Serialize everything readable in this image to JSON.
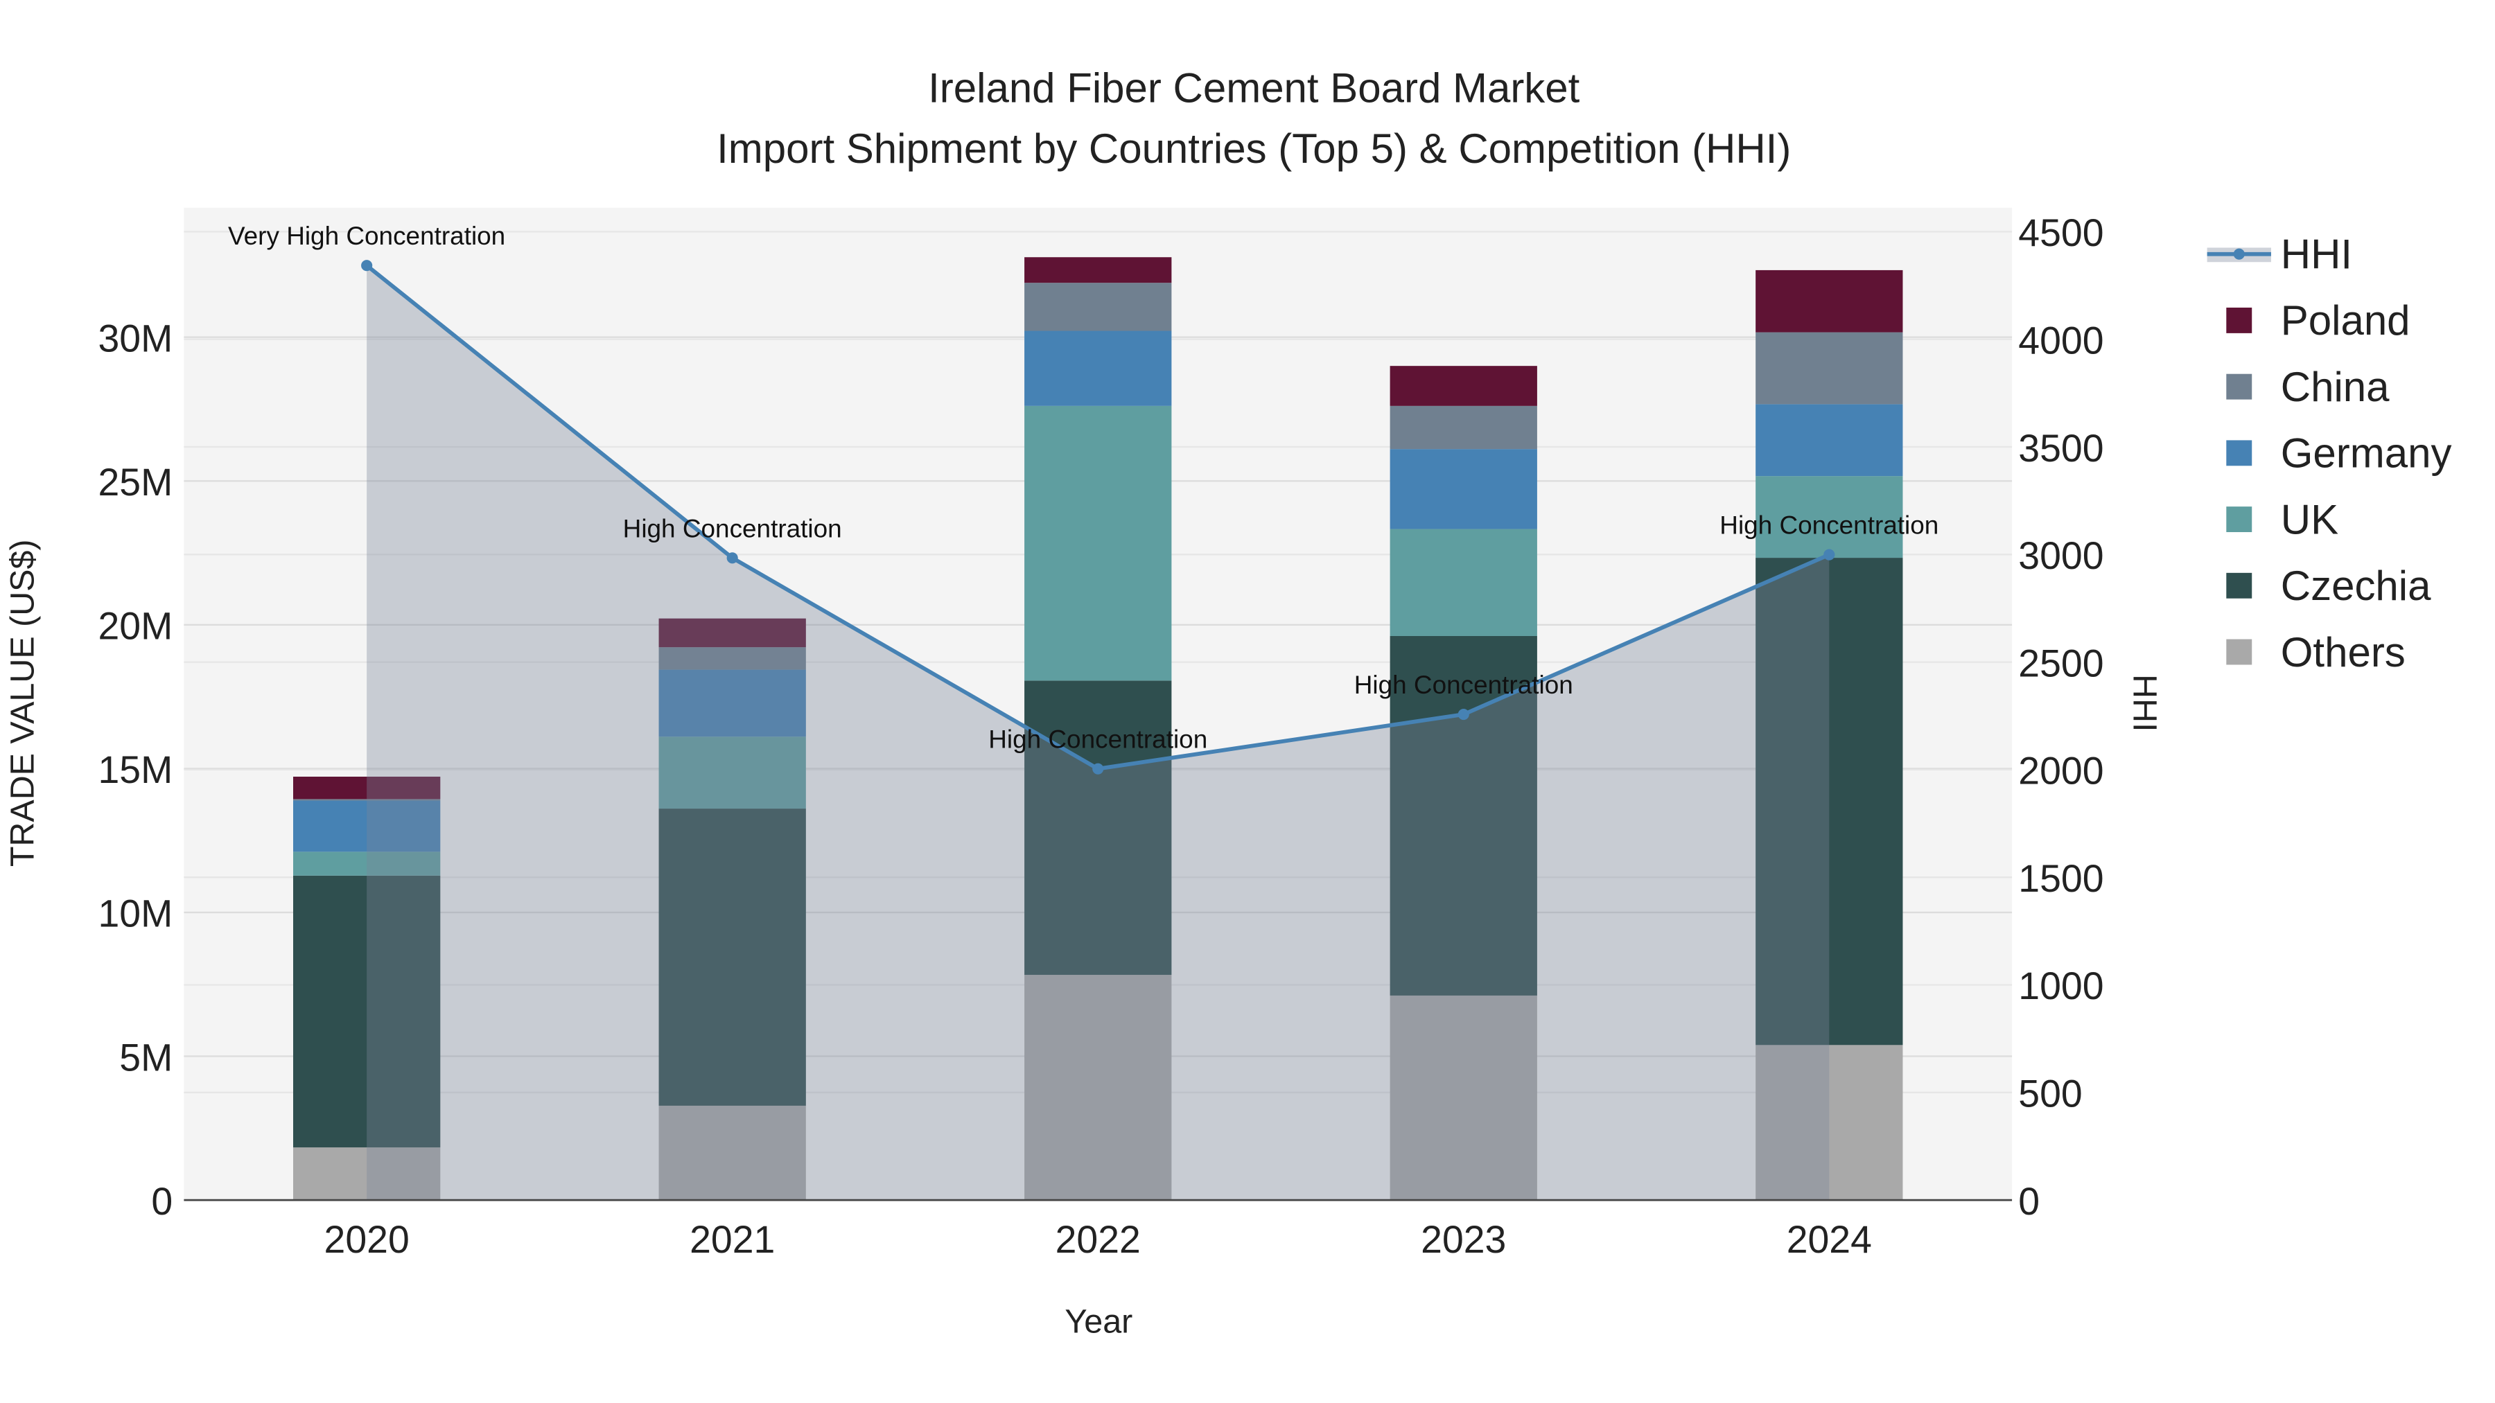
{
  "chart_data": {
    "type": "bar",
    "stacked": true,
    "title": "Ireland Fiber Cement Board Market",
    "subtitle": "Import Shipment by Countries (Top 5) & Competition (HHI)",
    "xlabel": "Year",
    "ylabel": "TRADE VALUE (US$)",
    "y2label": "HHI",
    "categories": [
      "2020",
      "2021",
      "2022",
      "2023",
      "2024"
    ],
    "ylim": [
      0,
      34500000
    ],
    "y2lim": [
      0,
      4600
    ],
    "yticks": [
      {
        "v": 0,
        "label": "0"
      },
      {
        "v": 5000000,
        "label": "5M"
      },
      {
        "v": 10000000,
        "label": "10M"
      },
      {
        "v": 15000000,
        "label": "15M"
      },
      {
        "v": 20000000,
        "label": "20M"
      },
      {
        "v": 25000000,
        "label": "25M"
      },
      {
        "v": 30000000,
        "label": "30M"
      }
    ],
    "y2ticks": [
      {
        "v": 0,
        "label": "0"
      },
      {
        "v": 500,
        "label": "500"
      },
      {
        "v": 1000,
        "label": "1000"
      },
      {
        "v": 1500,
        "label": "1500"
      },
      {
        "v": 2000,
        "label": "2000"
      },
      {
        "v": 2500,
        "label": "2500"
      },
      {
        "v": 3000,
        "label": "3000"
      },
      {
        "v": 3500,
        "label": "3500"
      },
      {
        "v": 4000,
        "label": "4000"
      },
      {
        "v": 4500,
        "label": "4500"
      }
    ],
    "grid": true,
    "legend_position": "right",
    "series": [
      {
        "name": "Others",
        "color": "#a9a9a9",
        "values": [
          1830000,
          3280000,
          7830000,
          7110000,
          5390000
        ]
      },
      {
        "name": "Czechia",
        "color": "#2f4f4f",
        "values": [
          9450000,
          10330000,
          10230000,
          12500000,
          16940000
        ]
      },
      {
        "name": "UK",
        "color": "#5f9ea0",
        "values": [
          830000,
          2500000,
          9550000,
          3720000,
          2840000
        ]
      },
      {
        "name": "Germany",
        "color": "#4682b4",
        "values": [
          1780000,
          2330000,
          2610000,
          2780000,
          2500000
        ]
      },
      {
        "name": "China",
        "color": "#708090",
        "values": [
          50000,
          780000,
          1670000,
          1500000,
          2500000
        ]
      },
      {
        "name": "Poland",
        "color": "#5f1334",
        "values": [
          780000,
          1000000,
          890000,
          1390000,
          2160000
        ]
      }
    ],
    "line": {
      "name": "HHI",
      "color": "#4682b4",
      "axis": "y2",
      "values": [
        4343,
        2984,
        2004,
        2257,
        2999
      ],
      "annotations": [
        "Very High Concentration",
        "High Concentration",
        "High Concentration",
        "High Concentration",
        "High Concentration"
      ]
    },
    "legend": [
      "HHI",
      "Poland",
      "China",
      "Germany",
      "UK",
      "Czechia",
      "Others"
    ]
  }
}
